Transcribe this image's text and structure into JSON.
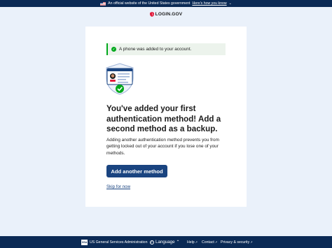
{
  "banner": {
    "text": "An official website of the United States government",
    "link": "Here's how you know"
  },
  "header": {
    "logo_text": "LOGIN.GOV"
  },
  "alert": {
    "message": "A phone was added to your account."
  },
  "main": {
    "title": "You've added your first authentication method! Add a second method as a backup.",
    "body": "Adding another authentication method prevents you from getting locked out of your account if you lose one of your methods.",
    "primary_button": "Add another method",
    "skip_link": "Skip for now"
  },
  "footer": {
    "agency": "US General Services Administration",
    "agency_badge": "GSA",
    "language": "Language",
    "help": "Help",
    "contact": "Contact",
    "privacy": "Privacy & security"
  },
  "colors": {
    "banner_bg": "#0b2a55",
    "page_bg": "#eaf1fa",
    "primary": "#1a4480",
    "success": "#00a91c",
    "alert_bg": "#ecf3ec",
    "logo_red": "#e21c3d"
  }
}
